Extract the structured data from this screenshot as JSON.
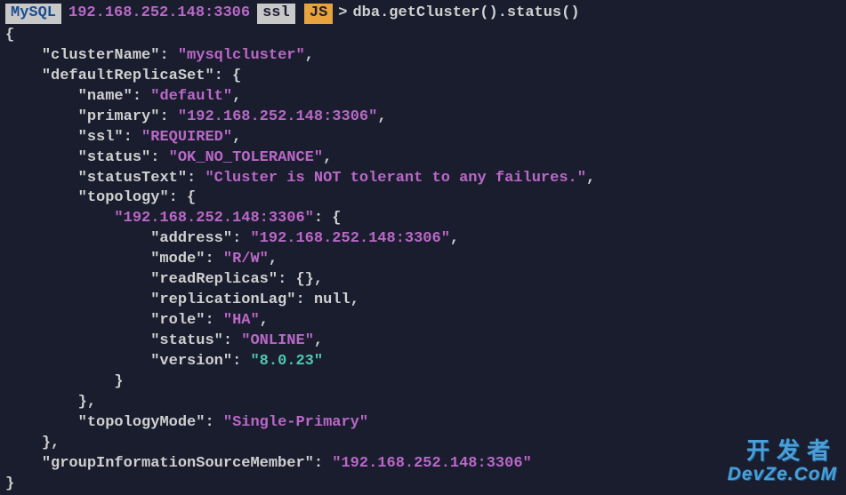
{
  "prompt": {
    "mysql": "MySQL",
    "host": "192.168.252.148:3306",
    "ssl": "ssl",
    "js": "JS",
    "arrow": ">",
    "command": "dba.getCluster().status()"
  },
  "output": {
    "clusterName": "mysqlcluster",
    "defaultReplicaSet": {
      "name": "default",
      "primary": "192.168.252.148:3306",
      "ssl": "REQUIRED",
      "status": "OK_NO_TOLERANCE",
      "statusText": "Cluster is NOT tolerant to any failures.",
      "topologyKey": "192.168.252.148:3306",
      "node": {
        "address": "192.168.252.148:3306",
        "mode": "R/W",
        "readReplicas": "{}",
        "replicationLag": "null",
        "role": "HA",
        "status": "ONLINE",
        "version": "8.0.23"
      },
      "topologyMode": "Single-Primary"
    },
    "groupInformationSourceMember": "192.168.252.148:3306"
  },
  "watermark": {
    "cn": "开发者",
    "en": "DevZe.CoM"
  }
}
